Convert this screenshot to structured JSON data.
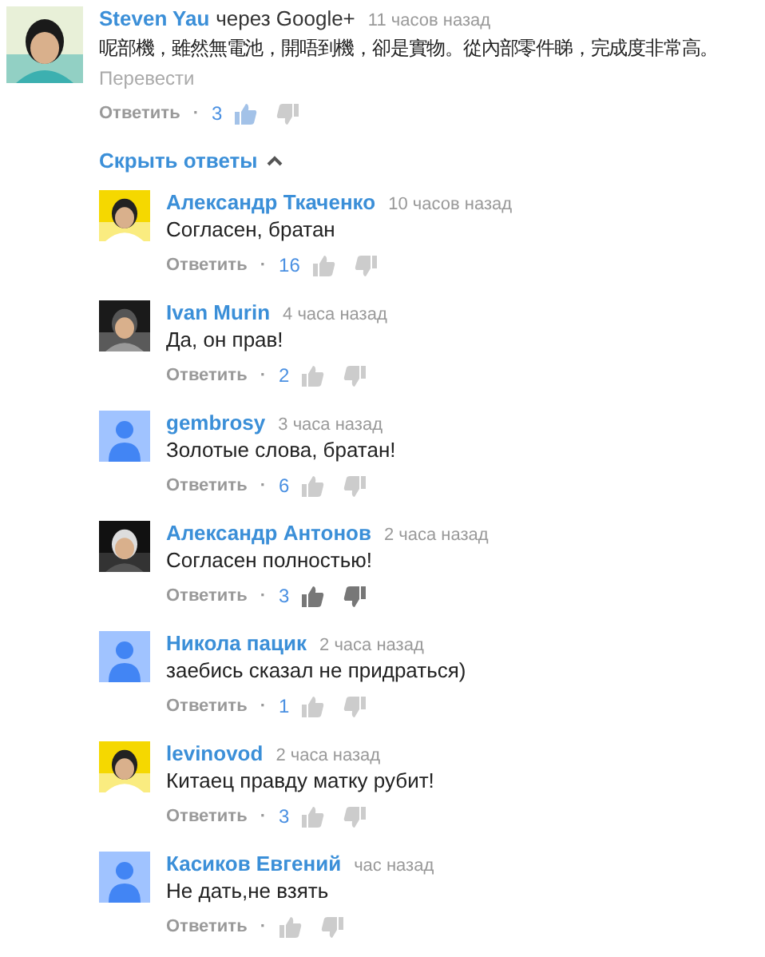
{
  "comment": {
    "author": "Steven Yau",
    "via": "через Google+",
    "time": "11 часов назад",
    "text": "呢部機，雖然無電池，開唔到機，卻是實物。從內部零件睇，完成度非常高。",
    "translate": "Перевести",
    "reply": "Ответить",
    "separator": "·",
    "count": "3",
    "liked": true,
    "highlighted": false
  },
  "toggle": {
    "label": "Скрыть ответы",
    "expanded": true
  },
  "replies": [
    {
      "author": "Александр Ткаченко",
      "time": "10 часов назад",
      "text": "Согласен, братан",
      "reply": "Ответить",
      "count": "16",
      "liked": false,
      "highlighted": false
    },
    {
      "author": "Ivan Murin",
      "time": "4 часа назад",
      "text": "Да, он прав!",
      "reply": "Ответить",
      "count": "2",
      "liked": false,
      "highlighted": false
    },
    {
      "author": "gembrosy",
      "time": "3 часа назад",
      "text": "Золотые слова, братан!",
      "reply": "Ответить",
      "count": "6",
      "liked": false,
      "highlighted": false,
      "avatar": {
        "kind": "default"
      }
    },
    {
      "author": "Александр Антонов",
      "time": "2 часа назад",
      "text": "Согласен полностью!",
      "reply": "Ответить",
      "count": "3",
      "liked": false,
      "highlighted": true
    },
    {
      "author": "Никола пацик",
      "time": "2 часа назад",
      "text": "заебись сказал не придраться)",
      "reply": "Ответить",
      "count": "1",
      "liked": false,
      "highlighted": false,
      "avatar": {
        "kind": "default"
      }
    },
    {
      "author": "levinovod",
      "time": "2 часа назад",
      "text": "Китаец правду матку рубит!",
      "reply": "Ответить",
      "count": "3",
      "liked": false,
      "highlighted": false
    },
    {
      "author": "Касиков Евгений",
      "time": "час назад",
      "text": "Не дать,не взять",
      "reply": "Ответить",
      "liked": false,
      "highlighted": false,
      "avatar": {
        "kind": "default"
      }
    }
  ]
}
